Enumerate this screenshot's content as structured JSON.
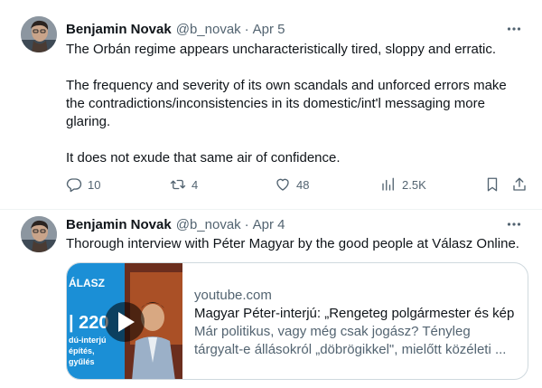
{
  "tweets": [
    {
      "author": {
        "name": "Benjamin Novak",
        "handle": "@b_novak",
        "separator": "·",
        "date": "Apr 5"
      },
      "paragraphs": [
        "The Orbán regime appears uncharacteristically tired, sloppy and erratic.",
        "The frequency and severity of its own scandals and unforced errors make the contradictions/inconsistencies in its domestic/int'l messaging more glaring.",
        "It does not exude that same air of confidence."
      ],
      "actions": {
        "reply": {
          "icon": "reply-icon",
          "count": "10"
        },
        "retweet": {
          "icon": "retweet-icon",
          "count": "4"
        },
        "like": {
          "icon": "heart-icon",
          "count": "48"
        },
        "views": {
          "icon": "views-icon",
          "count": "2.5K"
        },
        "bookmark": {
          "icon": "bookmark-icon"
        },
        "share": {
          "icon": "share-icon"
        }
      }
    },
    {
      "author": {
        "name": "Benjamin Novak",
        "handle": "@b_novak",
        "separator": "·",
        "date": "Apr 4"
      },
      "text": "Thorough interview with Péter Magyar by the good people at Válasz Online.",
      "card": {
        "domain": "youtube.com",
        "title": "Magyar Péter-interjú: „Rengeteg polgármester és kép",
        "description_line1": "Már politikus, vagy még csak jogász? Tényleg",
        "description_line2": "tárgyalt-e állásokról „döbrögikkel\", mielőtt közéleti ...",
        "thumb_text": {
          "line1": "ÁLASZ",
          "line2": "| 220",
          "line3": "dú-interjú",
          "line4": "építés,",
          "line5": "gyűlés"
        }
      }
    }
  ],
  "colors": {
    "text_primary": "#0f1419",
    "text_secondary": "#536471",
    "border": "#cfd9de",
    "thumb_blue": "#1b8fd6"
  }
}
